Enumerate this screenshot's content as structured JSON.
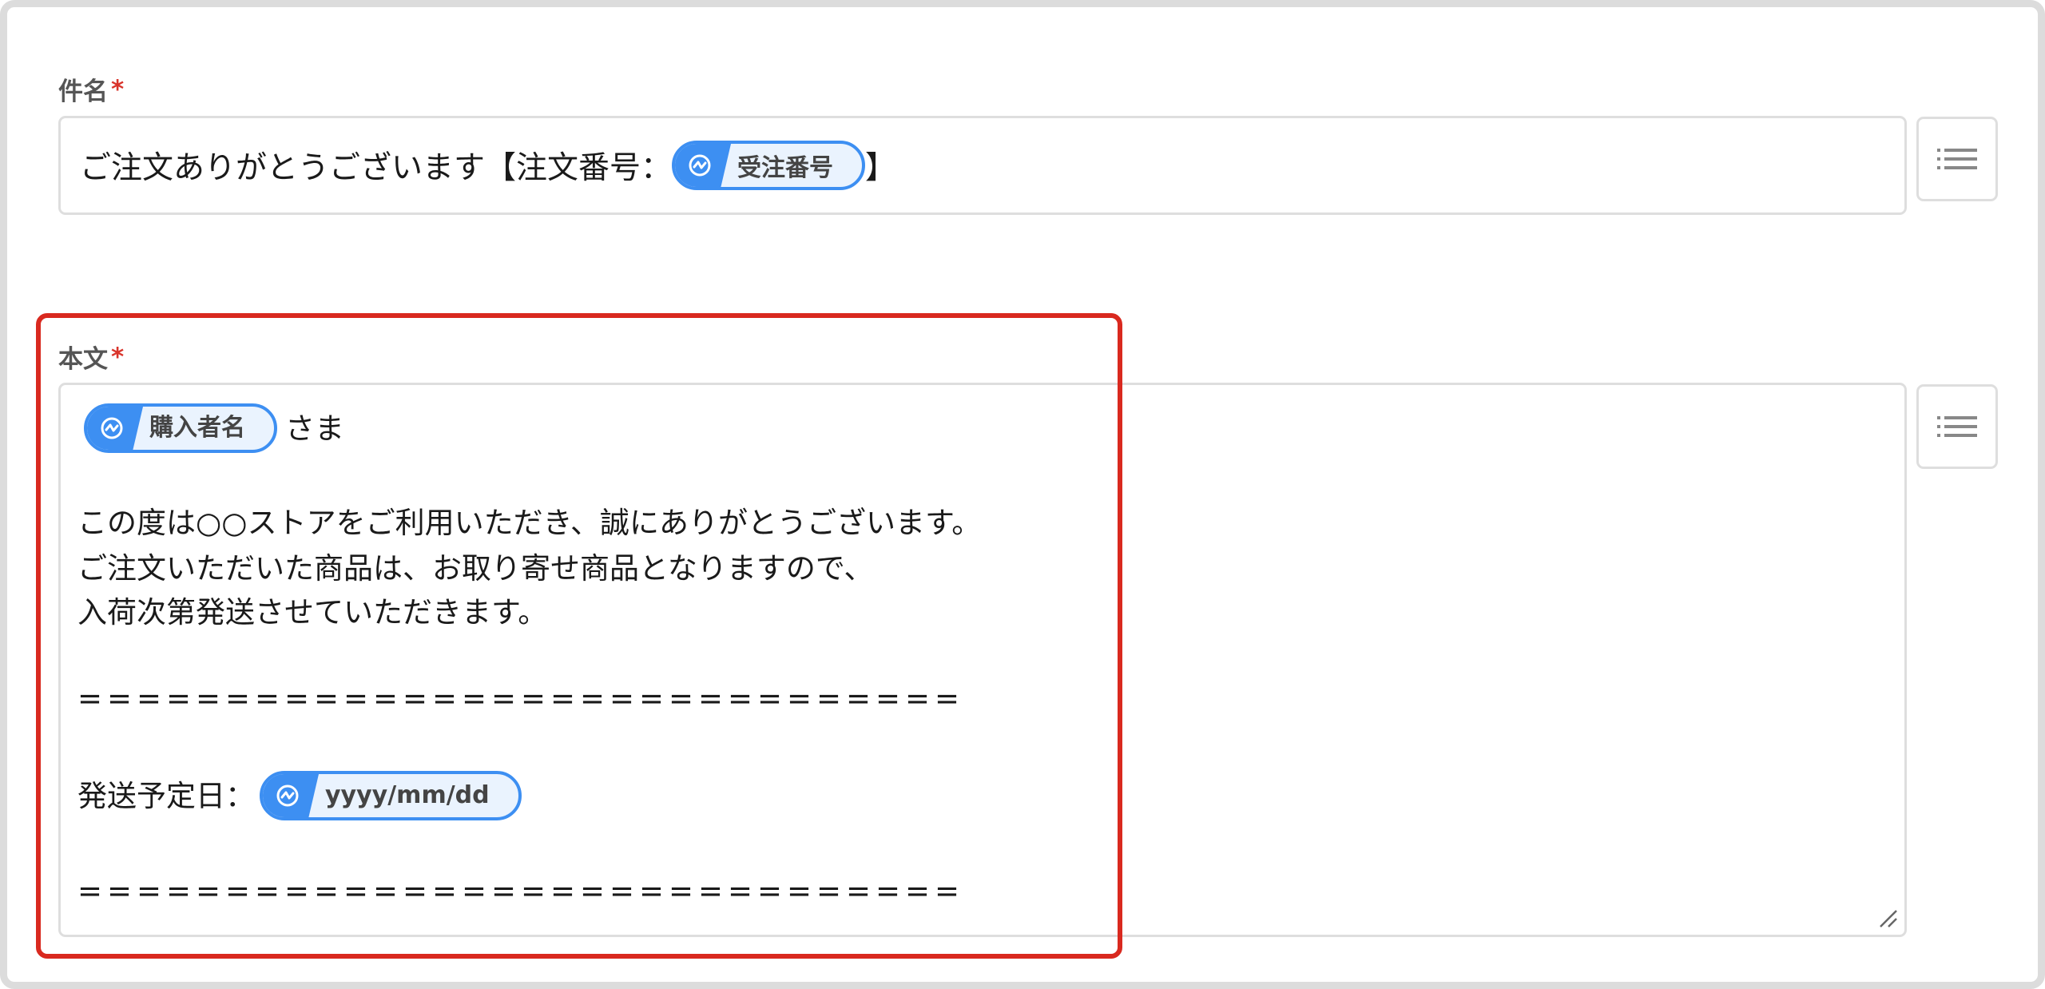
{
  "subject": {
    "label": "件名",
    "required_mark": "*",
    "prefix_text": "ご注文ありがとうございます【注文番号：",
    "chip_label": "受注番号",
    "suffix_text": "】",
    "insert_button_icon": "list-icon"
  },
  "body": {
    "label": "本文",
    "required_mark": "*",
    "recipient_chip": "購入者名",
    "recipient_suffix": "さま",
    "line1": "この度は○○ストアをご利用いただき、誠にありがとうございます。",
    "line2": "ご注文いただいた商品は、お取り寄せ商品となりますので、",
    "line3": "入荷次第発送させていただきます。",
    "separator": "==============================",
    "ship_label": "発送予定日：",
    "ship_chip": "yyyy/mm/dd",
    "separator2": "==============================",
    "insert_button_icon": "list-icon"
  },
  "colors": {
    "chip_blue": "#3d8ff2",
    "chip_fill": "#eaf3fe",
    "required_red": "#d9342b",
    "highlight_red": "#d9291f",
    "border_gray": "#dedede"
  }
}
